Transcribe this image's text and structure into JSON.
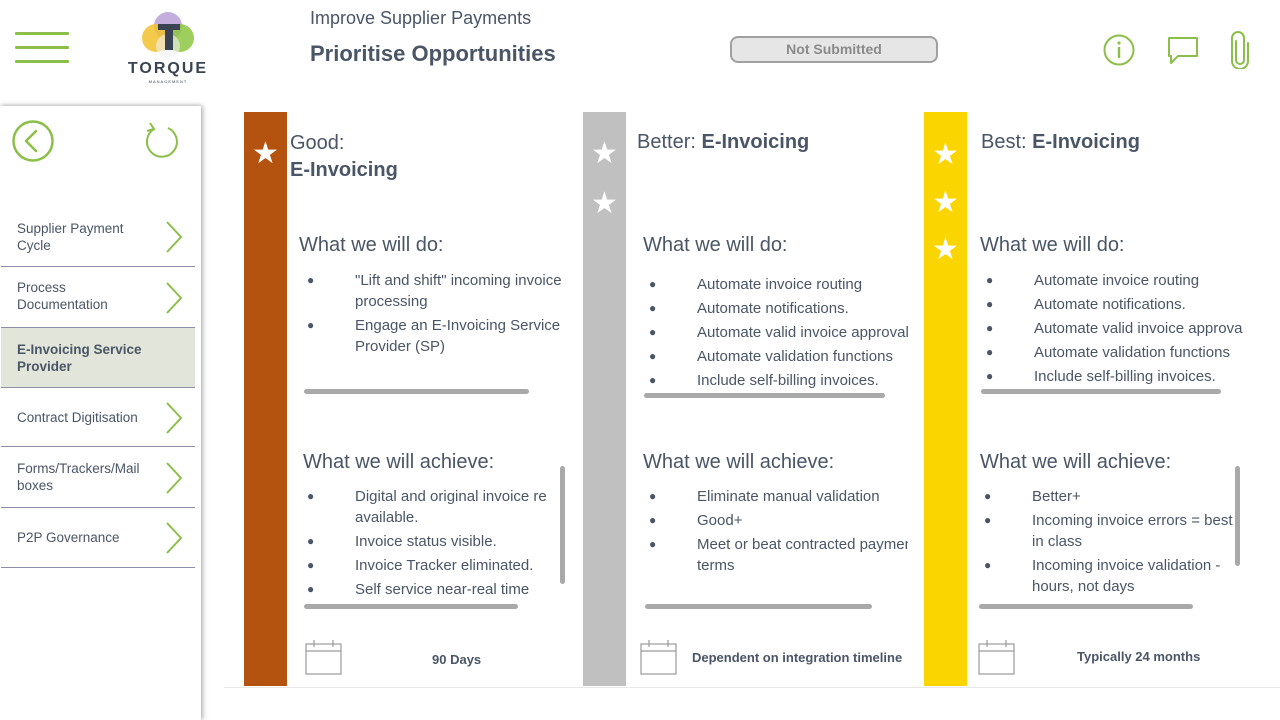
{
  "header": {
    "breadcrumb": "Improve Supplier Payments",
    "title": "Prioritise Opportunities",
    "status": "Not Submitted",
    "logo_text": "TORQUE",
    "logo_sub": "MANAGEMENT",
    "icons": [
      "info-icon",
      "comment-icon",
      "paperclip-icon"
    ]
  },
  "sidebar": {
    "items": [
      {
        "label": "Supplier Payment Cycle",
        "active": false
      },
      {
        "label": "Process Documentation",
        "active": false
      },
      {
        "label": "E-Invoicing Service Provider",
        "active": true
      },
      {
        "label": "Contract Digitisation",
        "active": false
      },
      {
        "label": "Forms/Trackers/Mail boxes",
        "active": false
      },
      {
        "label": "P2P Governance",
        "active": false
      }
    ]
  },
  "cards": [
    {
      "tier": "Good:",
      "name": "E-Invoicing",
      "stars": 1,
      "color": "#b3530f",
      "do_heading": "What we will do:",
      "do_items": [
        "\"Lift and shift\" incoming invoice processing",
        "Engage an E-Invoicing Service Provider (SP)"
      ],
      "achieve_heading": "What we will achieve:",
      "achieve_items": [
        "Digital and original invoice re available.",
        "Invoice status visible.",
        "Invoice Tracker eliminated.",
        "Self service near-real time"
      ],
      "timeline": "90 Days"
    },
    {
      "tier": "Better:",
      "name": "E-Invoicing",
      "stars": 2,
      "color": "#c0c0c0",
      "do_heading": "What we will do:",
      "do_items": [
        "Automate invoice routing",
        "Automate notifications.",
        "Automate valid invoice approvals",
        "Automate validation functions",
        "Include self-billing invoices."
      ],
      "achieve_heading": "What we will achieve:",
      "achieve_items": [
        "Eliminate manual validation",
        "Good+",
        "Meet or beat contracted payment terms"
      ],
      "timeline": "Dependent on integration timeline"
    },
    {
      "tier": "Best:",
      "name": "E-Invoicing",
      "stars": 3,
      "color": "#fbd500",
      "do_heading": "What we will do:",
      "do_items": [
        "Automate invoice routing",
        "Automate notifications.",
        "Automate valid invoice approvals",
        "Automate validation functions",
        "Include self-billing invoices."
      ],
      "achieve_heading": "What we will achieve:",
      "achieve_items": [
        "Better+",
        "Incoming invoice errors = best in class",
        "Incoming invoice validation - hours, not days"
      ],
      "timeline": "Typically 24 months"
    }
  ],
  "colors": {
    "accent": "#8cbf4a",
    "text": "#4a5566",
    "scroll": "#a9a9a9"
  }
}
